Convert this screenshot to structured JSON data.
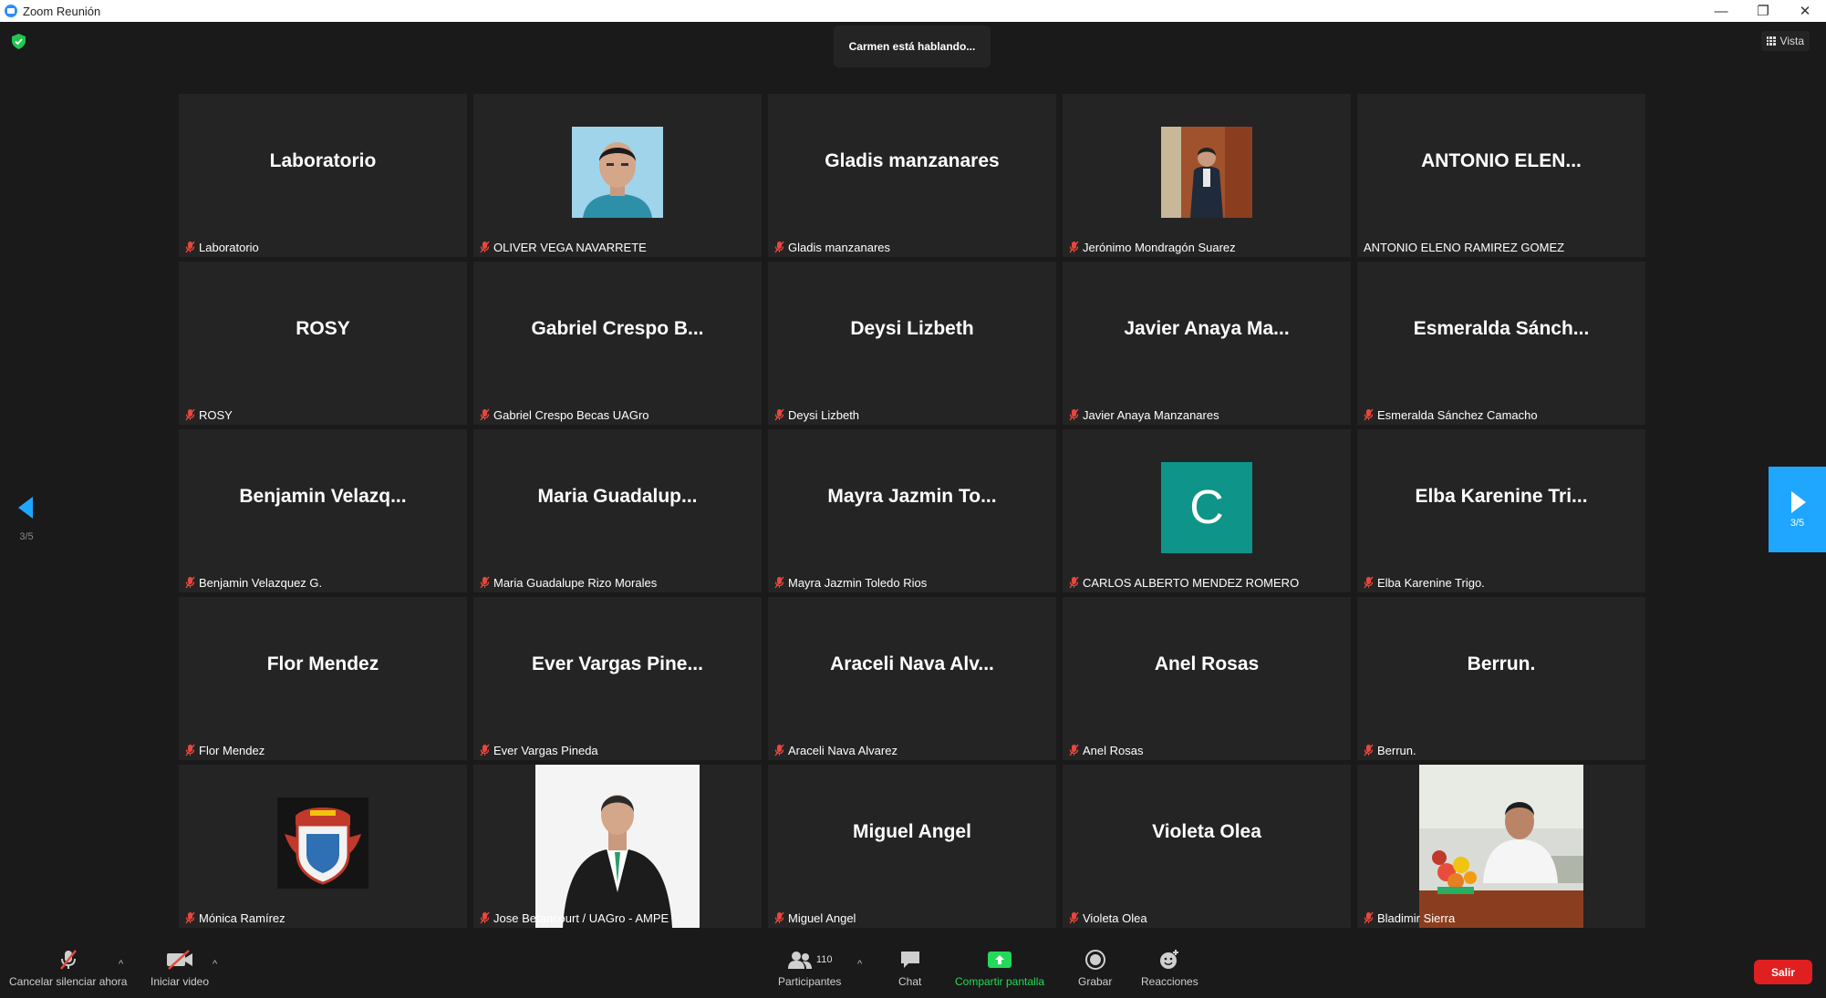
{
  "window": {
    "title": "Zoom Reunión",
    "controls": [
      "—",
      "❐",
      "✕"
    ]
  },
  "meeting": {
    "speaking_banner": "Carmen está hablando...",
    "view_button": "Vista",
    "page_indicator_left": "3/5",
    "page_indicator_right": "3/5"
  },
  "tiles": [
    {
      "display": "Laboratorio",
      "caption": "Laboratorio",
      "muted": true
    },
    {
      "display": "",
      "caption": "OLIVER VEGA NAVARRETE",
      "muted": true,
      "media": "portrait-photo"
    },
    {
      "display": "Gladis manzanares",
      "caption": "Gladis manzanares",
      "muted": true
    },
    {
      "display": "",
      "caption": "Jerónimo Mondragón Suarez",
      "muted": true,
      "media": "standing-photo"
    },
    {
      "display": "ANTONIO ELEN...",
      "caption": "ANTONIO ELENO RAMIREZ GOMEZ",
      "muted": false
    },
    {
      "display": "ROSY",
      "caption": "ROSY",
      "muted": true
    },
    {
      "display": "Gabriel Crespo B...",
      "caption": "Gabriel Crespo Becas UAGro",
      "muted": true
    },
    {
      "display": "Deysi Lizbeth",
      "caption": "Deysi Lizbeth",
      "muted": true
    },
    {
      "display": "Javier Anaya Ma...",
      "caption": "Javier Anaya Manzanares",
      "muted": true
    },
    {
      "display": "Esmeralda Sánch...",
      "caption": "Esmeralda Sánchez Camacho",
      "muted": true
    },
    {
      "display": "Benjamin Velazq...",
      "caption": "Benjamin Velazquez G.",
      "muted": true
    },
    {
      "display": "Maria Guadalup...",
      "caption": "Maria Guadalupe Rizo Morales",
      "muted": true
    },
    {
      "display": "Mayra Jazmin To...",
      "caption": "Mayra Jazmin Toledo Rios",
      "muted": true
    },
    {
      "display": "",
      "caption": "CARLOS ALBERTO MENDEZ ROMERO",
      "muted": true,
      "media": "initial",
      "initial": "C"
    },
    {
      "display": "Elba Karenine Tri...",
      "caption": "Elba Karenine Trigo.",
      "muted": true
    },
    {
      "display": "Flor Mendez",
      "caption": "Flor Mendez",
      "muted": true
    },
    {
      "display": "Ever Vargas Pine...",
      "caption": "Ever Vargas Pineda",
      "muted": true
    },
    {
      "display": "Araceli Nava Alv...",
      "caption": "Araceli Nava Alvarez",
      "muted": true
    },
    {
      "display": "Anel Rosas",
      "caption": "Anel Rosas",
      "muted": true
    },
    {
      "display": "Berrun.",
      "caption": "Berrun.",
      "muted": true
    },
    {
      "display": "",
      "caption": "Mónica Ramírez",
      "muted": true,
      "media": "crest-logo"
    },
    {
      "display": "",
      "caption": "Jose Betancourt / UAGro - AMPE",
      "muted": true,
      "media": "suit-photo"
    },
    {
      "display": "Miguel Angel",
      "caption": "Miguel Angel",
      "muted": true
    },
    {
      "display": "Violeta Olea",
      "caption": "Violeta Olea",
      "muted": true
    },
    {
      "display": "",
      "caption": "Bladimir Sierra",
      "muted": true,
      "media": "desk-photo"
    }
  ],
  "toolbar": {
    "unmute_label": "Cancelar silenciar ahora",
    "video_label": "Iniciar video",
    "participants_label": "Participantes",
    "participants_count": "110",
    "chat_label": "Chat",
    "share_label": "Compartir pantalla",
    "record_label": "Grabar",
    "reactions_label": "Reacciones",
    "leave_label": "Salir",
    "caret": "^"
  },
  "colors": {
    "background": "#1a1a1a",
    "tile": "#242424",
    "accent_blue": "#1fa7ff",
    "share_green": "#23d959",
    "leave_red": "#e02020",
    "mute_red": "#e8473c",
    "avatar_teal": "#0e9488"
  }
}
